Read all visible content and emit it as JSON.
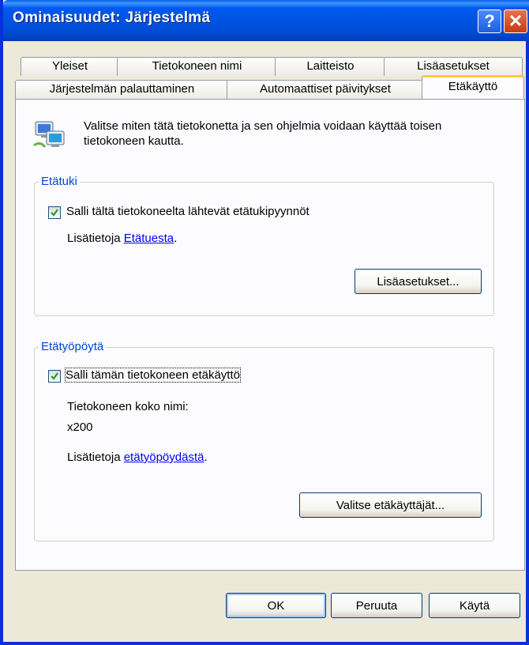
{
  "window": {
    "title": "Ominaisuudet: Järjestelmä"
  },
  "titlebar": {
    "help_label": "?",
    "close_label": "✕"
  },
  "tabs": {
    "row1": [
      "Yleiset",
      "Tietokoneen nimi",
      "Laitteisto",
      "Lisäasetukset"
    ],
    "row2": [
      "Järjestelmän palauttaminen",
      "Automaattiset päivitykset",
      "Etäkäyttö"
    ],
    "active": "Etäkäyttö"
  },
  "intro": {
    "icon": "computer-remote-icon",
    "text": "Valitse miten tätä tietokonetta ja sen ohjelmia voidaan käyttää toisen tietokoneen kautta."
  },
  "remote_assistance": {
    "group_label": "Etätuki",
    "checkbox_label": "Salli tältä tietokoneelta lähtevät etätukipyynnöt",
    "checked": true,
    "info_prefix": "Lisätietoja ",
    "info_link": "Etätuesta",
    "info_suffix": ".",
    "advanced_button": "Lisäasetukset..."
  },
  "remote_desktop": {
    "group_label": "Etätyöpöytä",
    "checkbox_label": "Salli tämän tietokoneen etäkäyttö",
    "checked": true,
    "computer_name_label": "Tietokoneen koko nimi:",
    "computer_name_value": "x200",
    "info_prefix": "Lisätietoja ",
    "info_link": "etätyöpöydästä",
    "info_suffix": ".",
    "select_users_button": "Valitse etäkäyttäjät..."
  },
  "footer": {
    "ok": "OK",
    "cancel": "Peruuta",
    "apply": "Käytä"
  },
  "colors": {
    "titlebar": "#0054E3",
    "face": "#ECE9D8",
    "group_label": "#0046D5",
    "link": "#0000FF",
    "active_tab_accent": "#FFC83C"
  }
}
